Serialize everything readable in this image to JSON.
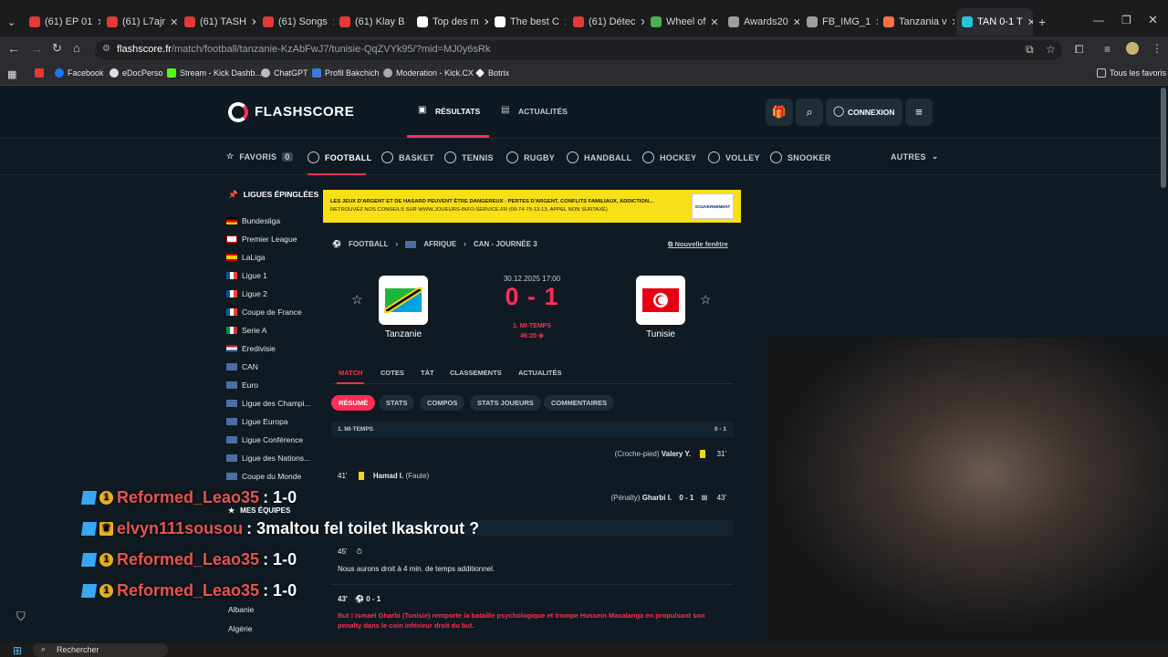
{
  "browser": {
    "tabs": [
      {
        "label": "(61) EP 01",
        "color": "#e53935"
      },
      {
        "label": "(61) L7ajr",
        "color": "#e53935"
      },
      {
        "label": "(61) TASH",
        "color": "#e53935"
      },
      {
        "label": "(61) Songs",
        "color": "#e53935"
      },
      {
        "label": "(61) Klay B",
        "color": "#e53935"
      },
      {
        "label": "Top des m",
        "color": "#ffffff"
      },
      {
        "label": "The best C",
        "color": "#ffffff"
      },
      {
        "label": "(61) Détec",
        "color": "#e53935"
      },
      {
        "label": "Wheel of",
        "color": "#4caf50"
      },
      {
        "label": "Awards20",
        "color": "#9e9e9e"
      },
      {
        "label": "FB_IMG_1",
        "color": "#9e9e9e"
      },
      {
        "label": "Tanzania v",
        "color": "#ff7043"
      },
      {
        "label": "TAN 0-1 T",
        "color": "#26c6da"
      }
    ],
    "url_domain": "flashscore.fr",
    "url_path": "/match/football/tanzanie-KzAbFwJ7/tunisie-QqZVYk95/?mid=MJ0y6sRk",
    "bookmarks": [
      "Facebook",
      "eDocPerso",
      "Stream - Kick Dashb...",
      "ChatGPT",
      "Profil Bakchich",
      "Moderation - Kick.CX",
      "Botrix"
    ],
    "all_bookmarks": "Tous les favoris"
  },
  "site": {
    "logo": "FLASHSCORE",
    "nav_results": "RÉSULTATS",
    "nav_news": "ACTUALITÉS",
    "login": "CONNEXION",
    "sports": [
      "FAVORIS",
      "FOOTBALL",
      "BASKET",
      "TENNIS",
      "RUGBY",
      "HANDBALL",
      "HOCKEY",
      "VOLLEY",
      "SNOOKER"
    ],
    "favoris_count": "0",
    "others": "AUTRES",
    "pinned_title": "LIGUES ÉPINGLÉES",
    "leagues": [
      "Bundesliga",
      "Premier League",
      "LaLiga",
      "Ligue 1",
      "Ligue 2",
      "Coupe de France",
      "Serie A",
      "Eredivisie",
      "CAN",
      "Euro",
      "Ligue des Champi...",
      "Ligue Europa",
      "Ligue Conférence",
      "Ligue des Nations...",
      "Coupe du Monde"
    ],
    "my_teams": "MES ÉQUIPES",
    "teams_list": [
      "Albanie",
      "Algérie"
    ]
  },
  "banner": {
    "line1": "LES JEUX D'ARGENT ET DE HASARD PEUVENT ÊTRE DANGEREUX : PERTES D'ARGENT, CONFLITS FAMILIAUX, ADDICTION...",
    "line2": "RETROUVEZ NOS CONSEILS SUR WWW.JOUEURS-INFO-SERVICE.FR (09-74-75-13-13, APPEL NON SURTAXÉ)",
    "gov": "GOUVERNEMENT"
  },
  "match": {
    "breadcrumb": [
      "FOOTBALL",
      "AFRIQUE",
      "CAN - JOURNÉE 3"
    ],
    "new_window": "Nouvelle fenêtre",
    "home": "Tanzanie",
    "away": "Tunisie",
    "datetime": "30.12.2025 17:00",
    "score": "0 - 1",
    "status": "1. MI-TEMPS",
    "clock": "46:20",
    "tabs": [
      "MATCH",
      "COTES",
      "TÀT",
      "CLASSEMENTS",
      "ACTUALITÉS"
    ],
    "subtabs": [
      "RÉSUMÉ",
      "STATS",
      "COMPOS",
      "STATS JOUEURS",
      "COMMENTAIRES"
    ],
    "period": "1. MI-TEMPS",
    "period_score": "0 - 1",
    "events": {
      "e1_desc": "(Croche-pied)",
      "e1_player": "Valery Y.",
      "e1_min": "31'",
      "e2_min": "41'",
      "e2_player": "Hamad I.",
      "e2_desc": "(Faute)",
      "e3_desc": "(Pénalty)",
      "e3_player": "Gharbi I.",
      "e3_score": "0 - 1",
      "e3_min": "43'"
    },
    "comm": {
      "c1_min": "45'",
      "c1_text": "Nous aurons droit à 4 min. de temps additionnel.",
      "c2_min": "43'",
      "c2_score": "0 - 1",
      "c2_text": "But ! Ismael Gharbi (Tunisie) remporte la bataille psychologique et trompe Hussein Masalanga en propulsant son penalty dans le coin inférieur droit du but."
    }
  },
  "chat": [
    {
      "user": "Reformed_Leao35",
      "msg": ": 1-0",
      "color": "#e6544f"
    },
    {
      "user": "elvyn111sousou",
      "msg": ": 3maltou fel toilet lkaskrout ?",
      "color": "#e6544f"
    },
    {
      "user": "Reformed_Leao35",
      "msg": ": 1-0",
      "color": "#e6544f"
    },
    {
      "user": "Reformed_Leao35",
      "msg": ": 1-0",
      "color": "#e6544f"
    }
  ],
  "taskbar": {
    "search": "Rechercher"
  }
}
